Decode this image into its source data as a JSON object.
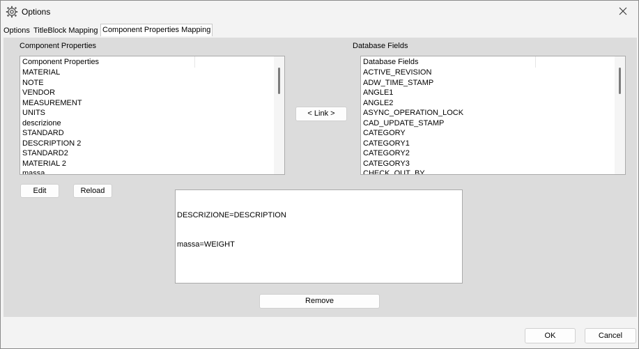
{
  "window": {
    "title": "Options",
    "close_icon": "close-icon",
    "app_icon": "gear-icon"
  },
  "tabs": [
    {
      "label": "Options",
      "active": false
    },
    {
      "label": "TitleBlock Mapping",
      "active": false
    },
    {
      "label": "Component Properties Mapping",
      "active": true
    }
  ],
  "component_properties": {
    "group_label": "Component Properties",
    "header": "Component Properties",
    "items": [
      "MATERIAL",
      "NOTE",
      "VENDOR",
      "MEASUREMENT",
      "UNITS",
      "descrizione",
      "STANDARD",
      "DESCRIPTION 2",
      "STANDARD2",
      "MATERIAL 2",
      "massa"
    ]
  },
  "database_fields": {
    "group_label": "Database Fields",
    "header": "Database Fields",
    "items": [
      "ACTIVE_REVISION",
      "ADW_TIME_STAMP",
      "ANGLE1",
      "ANGLE2",
      "ASYNC_OPERATION_LOCK",
      "CAD_UPDATE_STAMP",
      "CATEGORY",
      "CATEGORY1",
      "CATEGORY2",
      "CATEGORY3",
      "CHECK_OUT_BY"
    ]
  },
  "buttons": {
    "link": "< Link >",
    "edit": "Edit",
    "reload": "Reload",
    "remove": "Remove",
    "ok": "OK",
    "cancel": "Cancel"
  },
  "mappings": [
    "DESCRIZIONE=DESCRIPTION",
    "massa=WEIGHT"
  ]
}
